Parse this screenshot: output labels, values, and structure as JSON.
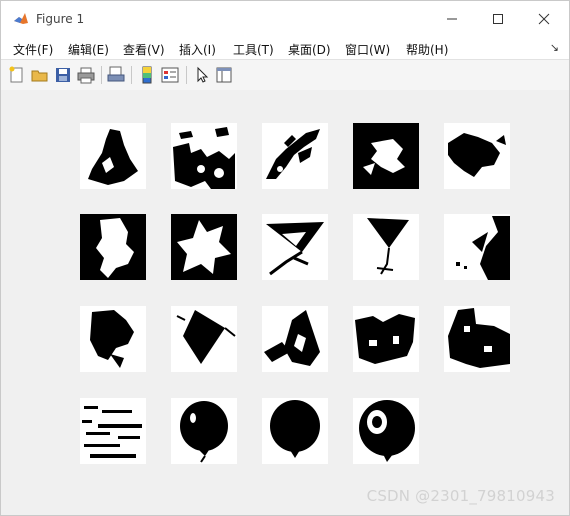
{
  "window": {
    "title": "Figure 1",
    "menu": [
      "文件(F)",
      "编辑(E)",
      "查看(V)",
      "插入(I)",
      "工具(T)",
      "桌面(D)",
      "窗口(W)",
      "帮助(H)"
    ],
    "menu_overflow": "↘"
  },
  "toolbar": {
    "icons": [
      "new-figure-icon",
      "open-folder-icon",
      "save-icon",
      "print-icon",
      "print-preview-icon",
      "colorbar-icon",
      "legend-icon",
      "select-arrow-icon",
      "property-editor-icon"
    ]
  },
  "figure": {
    "grid": {
      "rows": 4,
      "cols": 5,
      "count": 19
    },
    "tiles": [
      "cone-shape",
      "scattered-blobs",
      "scattered-strokes",
      "inverted-blob",
      "dark-blob",
      "inverted-blob-2",
      "inverted-star",
      "kite-outline",
      "kite-balloon",
      "diagonal-kite",
      "ink-blob",
      "diamond-kite",
      "scattered-kite",
      "crowd-blob",
      "noisy-blob",
      "sparse-noise",
      "balloon",
      "balloon-2",
      "balloon-highlight"
    ]
  },
  "watermark": "CSDN @2301_79810943"
}
